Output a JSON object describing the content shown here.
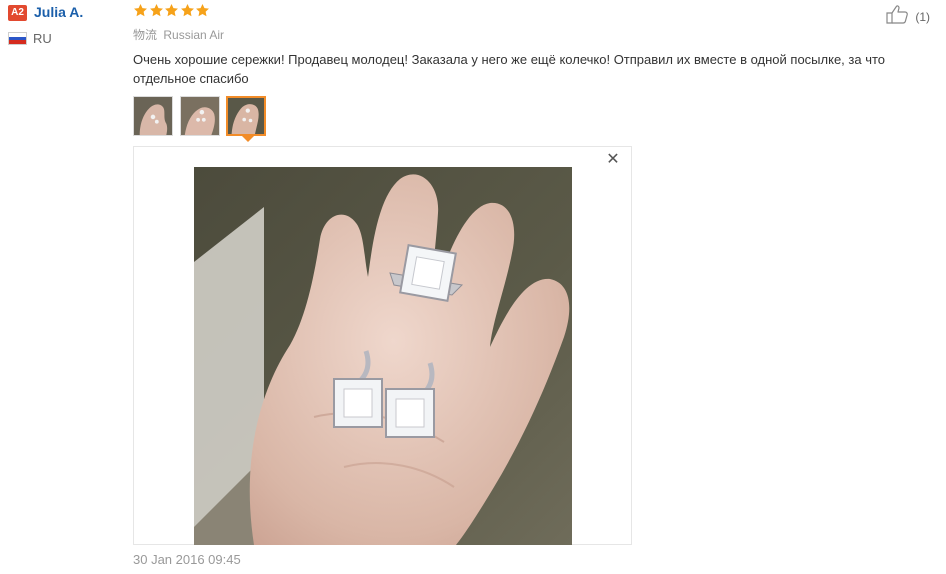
{
  "user": {
    "level_badge": "A2",
    "name": "Julia A.",
    "country": "RU",
    "flag_colors": [
      "#ffffff",
      "#2b56c8",
      "#d52b1e"
    ]
  },
  "review": {
    "rating": 5,
    "star_color": "#f6a21a",
    "logistics_label": "物流",
    "logistics_value": "Russian Air",
    "text": "Очень хорошие сережки! Продавец молодец! Заказала у него же ещё колечко! Отправил их вместе в одной посылке, за что отдельное спасибо",
    "date": "30 Jan 2016 09:45",
    "helpful_count": "(1)"
  },
  "gallery": {
    "thumbnails": [
      "thumb-photo-1",
      "thumb-photo-2",
      "thumb-photo-3"
    ],
    "active_index": 2,
    "close_glyph": "✕",
    "accent_color": "#f28c28"
  }
}
